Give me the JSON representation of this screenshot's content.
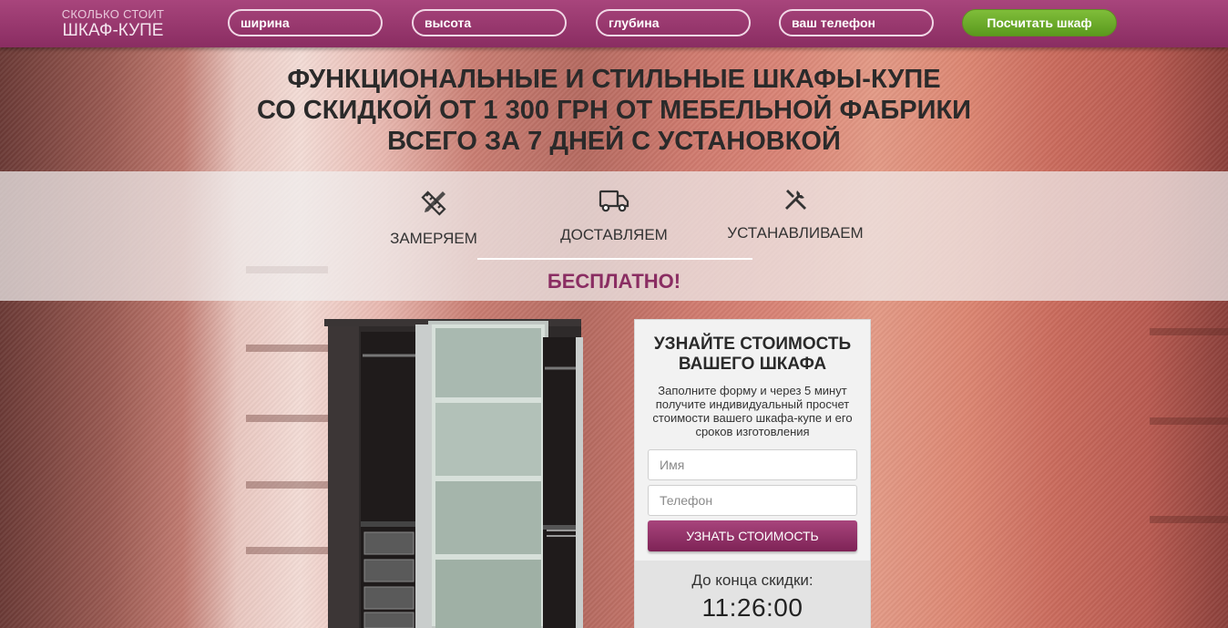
{
  "header": {
    "logo_line1": "СКОЛЬКО СТОИТ",
    "logo_line2": "ШКАФ-КУПЕ",
    "width_placeholder": "ширина",
    "height_placeholder": "высота",
    "depth_placeholder": "глубина",
    "phone_placeholder": "ваш телефон",
    "calc_button": "Посчитать шкаф"
  },
  "headline": {
    "line1": "ФУНКЦИОНАЛЬНЫЕ И СТИЛЬНЫЕ ШКАФЫ-КУПЕ",
    "line2": "СО СКИДКОЙ ОТ 1 300 ГРН ОТ МЕБЕЛЬНОЙ ФАБРИКИ",
    "line3": "ВСЕГО ЗА 7 ДНЕЙ С УСТАНОВКОЙ"
  },
  "features": [
    {
      "label": "ЗАМЕРЯЕМ",
      "icon": "ruler-pencil-icon"
    },
    {
      "label": "ДОСТАВЛЯЕМ",
      "icon": "truck-icon"
    },
    {
      "label": "УСТАНАВЛИВАЕМ",
      "icon": "tools-icon"
    }
  ],
  "free_label": "БЕСПЛАТНО!",
  "form": {
    "title_line1": "УЗНАЙТЕ СТОИМОСТЬ",
    "title_line2": "ВАШЕГО ШКАФА",
    "description": "Заполните форму и через 5 минут получите индивидуальный просчет стоимости вашего шкафа-купе и его сроков изготовления",
    "name_placeholder": "Имя",
    "phone_placeholder": "Телефон",
    "submit_label": "УЗНАТЬ СТОИМОСТЬ",
    "countdown_label": "До конца скидки:",
    "countdown_time": "11:26:00"
  },
  "colors": {
    "brand": "#8a2d62",
    "accent_green": "#6aab2a",
    "text_dark": "#2a2a2a"
  }
}
